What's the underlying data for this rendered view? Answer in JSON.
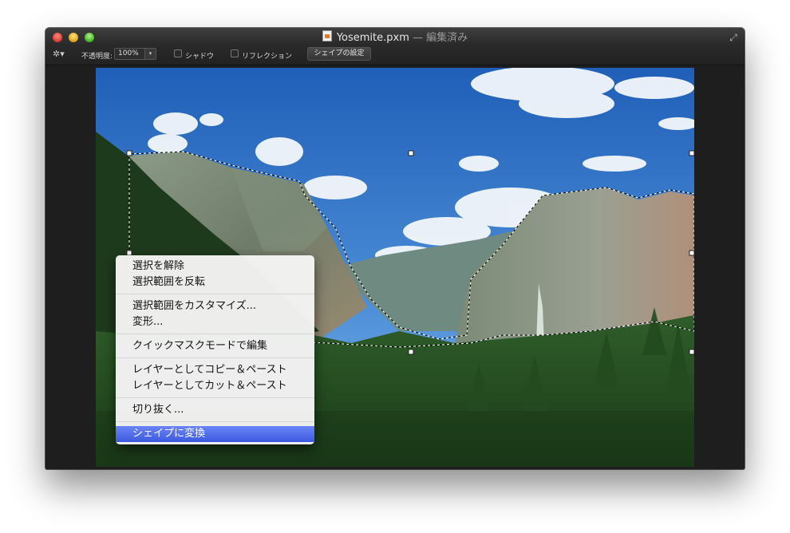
{
  "window": {
    "title": "Yosemite.pxm",
    "title_suffix": "— 編集済み"
  },
  "toolbar": {
    "opacity_label": "不透明度:",
    "opacity_value": "100%",
    "shadow_label": "シャドウ",
    "reflection_label": "リフレクション",
    "shape_settings_button": "シェイプの設定"
  },
  "icons": {
    "gear": "gear-icon",
    "fullscreen": "fullscreen-icon",
    "document": "document-icon"
  },
  "context_menu": {
    "groups": [
      [
        "選択を解除",
        "選択範囲を反転"
      ],
      [
        "選択範囲をカスタマイズ...",
        "変形..."
      ],
      [
        "クイックマスクモードで編集"
      ],
      [
        "レイヤーとしてコピー＆ペースト",
        "レイヤーとしてカット＆ペースト"
      ],
      [
        "切り抜く..."
      ],
      [
        "シェイプに変換"
      ]
    ],
    "highlighted": "シェイプに変換"
  },
  "colors": {
    "accent": "#3c5ae0",
    "window_bg": "#1e1e1e"
  }
}
